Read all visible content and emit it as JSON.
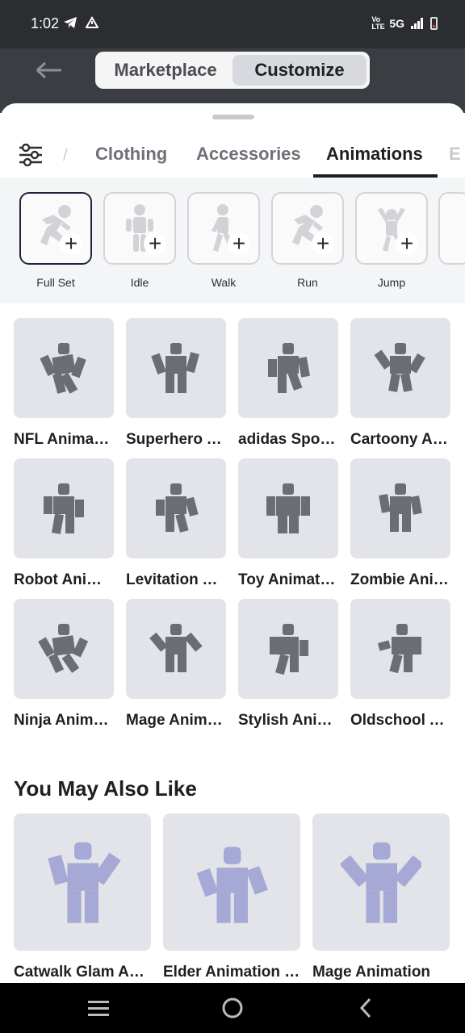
{
  "status": {
    "time": "1:02",
    "network": "5G",
    "volte": "Vo LTE",
    "icons": [
      "telegram-icon",
      "alert-icon",
      "signal-icon",
      "battery-icon"
    ]
  },
  "header": {
    "segments": [
      "Marketplace",
      "Customize"
    ],
    "active_segment": "Customize"
  },
  "tabs": {
    "items": [
      "Clothing",
      "Accessories",
      "Animations"
    ],
    "active": "Animations",
    "cut_off": "E"
  },
  "animation_slots": [
    {
      "label": "Full Set",
      "selected": true
    },
    {
      "label": "Idle",
      "selected": false
    },
    {
      "label": "Walk",
      "selected": false
    },
    {
      "label": "Run",
      "selected": false
    },
    {
      "label": "Jump",
      "selected": false
    }
  ],
  "items": [
    {
      "name": "NFL Animation Pack"
    },
    {
      "name": "Superhero Animation Pack"
    },
    {
      "name": "adidas Sports Animation Pack"
    },
    {
      "name": "Cartoony Animation Pack"
    },
    {
      "name": "Robot Animation Pack"
    },
    {
      "name": "Levitation Animation Pack"
    },
    {
      "name": "Toy Animation Pack"
    },
    {
      "name": "Zombie Animation Pack"
    },
    {
      "name": "Ninja Animation Pack"
    },
    {
      "name": "Mage Animation Pack"
    },
    {
      "name": "Stylish Animation Pack"
    },
    {
      "name": "Oldschool Animation Pack"
    }
  ],
  "recommendations": {
    "title": "You May Also Like",
    "items": [
      {
        "name": "Catwalk Glam Animation Pack"
      },
      {
        "name": "Elder Animation Package"
      },
      {
        "name": "Mage Animation"
      }
    ]
  },
  "colors": {
    "figure_gray": "#6b6d72",
    "figure_lavender": "#a6a8d6",
    "selected_border": "#1f2340"
  }
}
